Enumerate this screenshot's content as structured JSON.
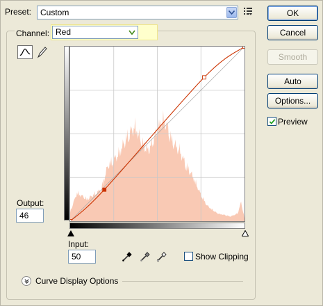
{
  "preset": {
    "label": "Preset:",
    "value": "Custom"
  },
  "channel": {
    "label": "Channel:",
    "value": "Red"
  },
  "output": {
    "label": "Output:",
    "value": "46"
  },
  "input": {
    "label": "Input:",
    "value": "50"
  },
  "show_clipping": {
    "label": "Show Clipping",
    "checked": false
  },
  "curve_display_options": {
    "label": "Curve Display Options"
  },
  "buttons": {
    "ok": "OK",
    "cancel": "Cancel",
    "smooth": "Smooth",
    "auto": "Auto",
    "options": "Options..."
  },
  "preview": {
    "label": "Preview",
    "checked": true
  },
  "colors": {
    "curve": "#cc3300",
    "histogram": "#f9c9b4",
    "grid": "#c8c8c8"
  },
  "curve_points": [
    [
      0,
      0
    ],
    [
      50,
      46
    ],
    [
      196,
      210
    ],
    [
      255,
      255
    ]
  ],
  "histogram_profile": [
    [
      0,
      0.06
    ],
    [
      10,
      0.18
    ],
    [
      25,
      0.14
    ],
    [
      45,
      0.2
    ],
    [
      55,
      0.35
    ],
    [
      70,
      0.42
    ],
    [
      85,
      0.55
    ],
    [
      95,
      0.6
    ],
    [
      105,
      0.5
    ],
    [
      115,
      0.45
    ],
    [
      125,
      0.55
    ],
    [
      135,
      0.65
    ],
    [
      142,
      0.6
    ],
    [
      150,
      0.5
    ],
    [
      160,
      0.45
    ],
    [
      170,
      0.35
    ],
    [
      180,
      0.28
    ],
    [
      190,
      0.18
    ],
    [
      200,
      0.1
    ],
    [
      215,
      0.05
    ],
    [
      235,
      0.03
    ],
    [
      245,
      0.05
    ],
    [
      250,
      0.12
    ],
    [
      255,
      0.02
    ]
  ]
}
